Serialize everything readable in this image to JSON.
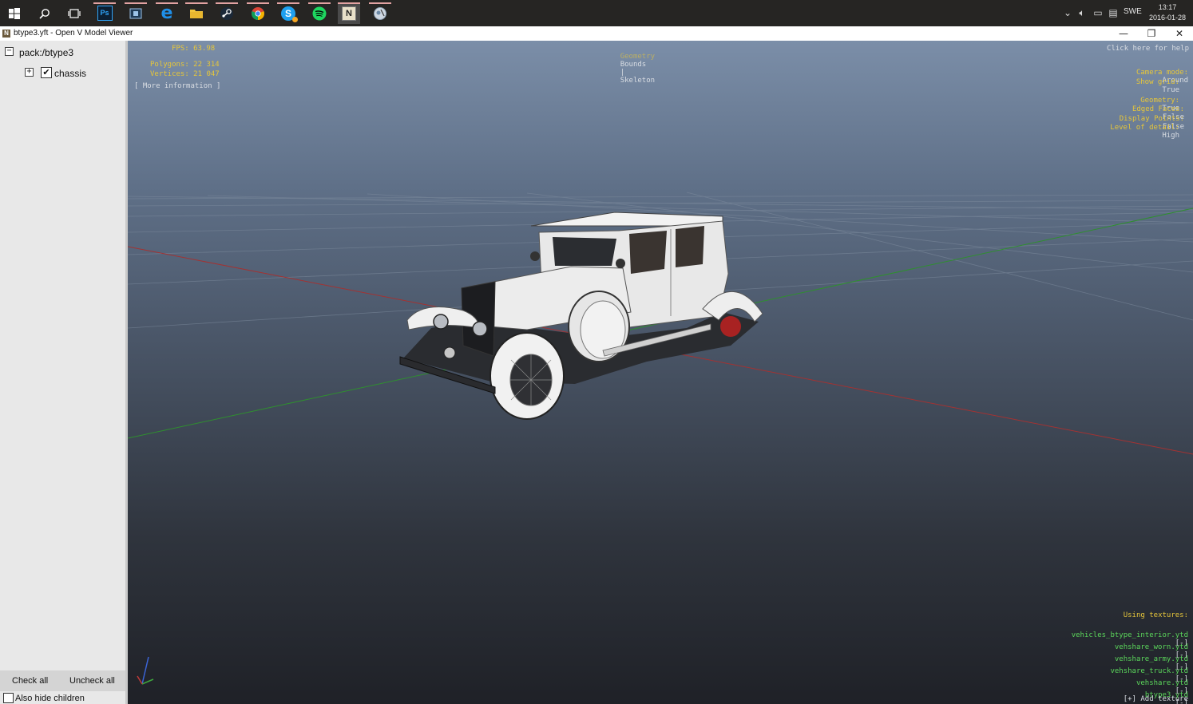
{
  "taskbar": {
    "apps": [
      {
        "name": "windows-start-icon"
      },
      {
        "name": "search-icon"
      },
      {
        "name": "task-view-icon"
      },
      {
        "name": "photoshop-icon",
        "label": "Ps",
        "color": "#2fa3f7"
      },
      {
        "name": "media-player-icon"
      },
      {
        "name": "edge-icon",
        "label": "e",
        "color": "#1f8fe8"
      },
      {
        "name": "file-explorer-icon",
        "color": "#f2c53d"
      },
      {
        "name": "steam-icon"
      },
      {
        "name": "chrome-icon"
      },
      {
        "name": "skype-icon",
        "label": "S",
        "color": "#1ea0f0"
      },
      {
        "name": "spotify-icon",
        "color": "#1ed760"
      },
      {
        "name": "openiv-icon",
        "label": "N"
      },
      {
        "name": "snip-icon"
      }
    ],
    "tray": {
      "lang": "SWE",
      "time": "13:17",
      "date": "2016-01-28"
    }
  },
  "window": {
    "title": "btype3.yft - Open V Model Viewer",
    "minimize": "—",
    "restore": "❐",
    "close": "✕"
  },
  "tree": {
    "root": "pack:/btype3",
    "child": "chassis",
    "child_checked": true,
    "check_all": "Check all",
    "uncheck_all": "Uncheck all",
    "hide_children": "Also hide children"
  },
  "hud": {
    "fps": "FPS: 63.98",
    "polygons": "Polygons: 22 314",
    "vertices": "Vertices: 21 047",
    "more_info": "[ More information ]",
    "tab_geometry": "Geometry",
    "tab_bounds": "Bounds",
    "tab_sep": "|",
    "tab_skeleton": "Skeleton",
    "help": "Click here for help",
    "camera_label": "Camera mode:",
    "camera_value": "Around",
    "grid_label": "Show grid:",
    "grid_value": "True",
    "geometry_label": "Geometry:",
    "geometry_value": "True",
    "edged_label": "Edged Faces:",
    "edged_value": "False",
    "points_label": "Display Points:",
    "points_value": "False",
    "lod_label": "Level of detail:",
    "lod_value": "High",
    "textures_title": "Using textures:",
    "textures": [
      "vehicles_btype_interior.ytd",
      "vehshare_worn.ytd",
      "vehshare_army.ytd",
      "vehshare_truck.ytd",
      "vehshare.ytd",
      "btype3.ytd"
    ],
    "remove_marker": "[-]",
    "add_texture": "[+] Add texture"
  },
  "colors": {
    "hud_yellow": "#e6c63a",
    "hud_green": "#5bd65b",
    "axis_red": "#a33232",
    "axis_green": "#2f8f2f"
  }
}
